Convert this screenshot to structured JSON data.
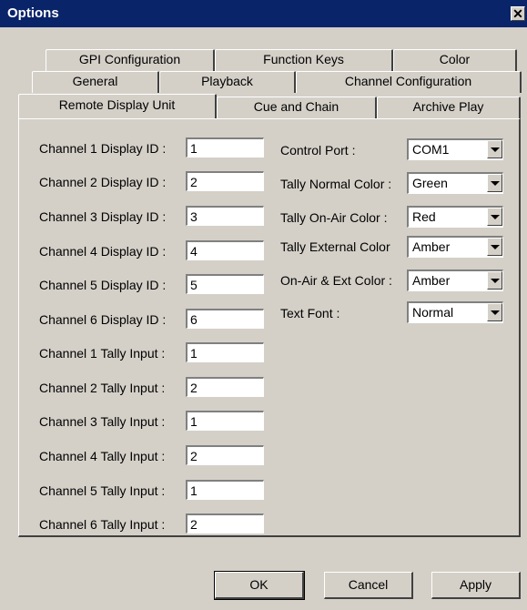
{
  "window": {
    "title": "Options",
    "close_glyph": "✕"
  },
  "tabs": {
    "row1": [
      "GPI Configuration",
      "Function Keys",
      "Color"
    ],
    "row2": [
      "General",
      "Playback",
      "Channel Configuration"
    ],
    "row3": [
      "Remote Display Unit",
      "Cue and Chain",
      "Archive Play"
    ],
    "active": "Remote Display Unit"
  },
  "display_ids": [
    {
      "label": "Channel 1 Display ID :",
      "value": "1"
    },
    {
      "label": "Channel 2 Display ID :",
      "value": "2"
    },
    {
      "label": "Channel 3 Display ID :",
      "value": "3"
    },
    {
      "label": "Channel 4 Display ID :",
      "value": "4"
    },
    {
      "label": "Channel 5 Display ID :",
      "value": "5"
    },
    {
      "label": "Channel 6 Display ID :",
      "value": "6"
    }
  ],
  "tally_inputs": [
    {
      "label": "Channel 1 Tally Input :",
      "value": "1"
    },
    {
      "label": "Channel 2 Tally Input :",
      "value": "2"
    },
    {
      "label": "Channel 3 Tally Input :",
      "value": "1"
    },
    {
      "label": "Channel 4 Tally Input :",
      "value": "2"
    },
    {
      "label": "Channel 5 Tally Input :",
      "value": "1"
    },
    {
      "label": "Channel 6 Tally Input :",
      "value": "2"
    }
  ],
  "settings": [
    {
      "label": "Control Port :",
      "value": "COM1"
    },
    {
      "label": "Tally Normal Color :",
      "value": "Green"
    },
    {
      "label": "Tally On-Air Color :",
      "value": "Red"
    },
    {
      "label": "Tally External Color",
      "value": "Amber"
    },
    {
      "label": "On-Air & Ext Color :",
      "value": "Amber"
    },
    {
      "label": "Text Font :",
      "value": "Normal"
    }
  ],
  "buttons": {
    "ok": "OK",
    "cancel": "Cancel",
    "apply": "Apply"
  },
  "colors": {
    "titlebar": "#0a246a",
    "face": "#d4d0c8"
  }
}
